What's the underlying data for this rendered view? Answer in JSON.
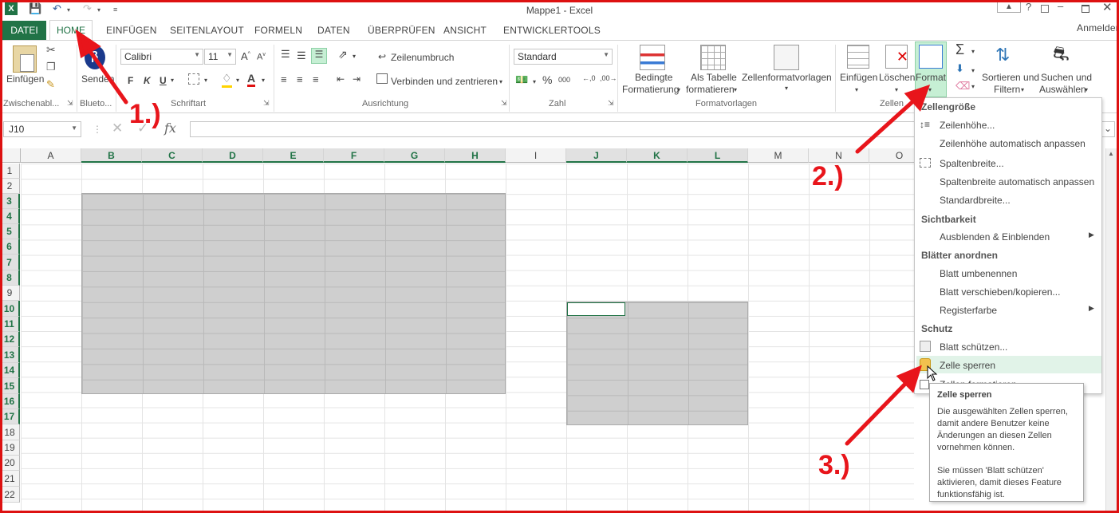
{
  "window": {
    "title": "Mappe1 - Excel",
    "signin": "Anmelden"
  },
  "tabs": [
    "DATEI",
    "HOME",
    "EINFÜGEN",
    "SEITENLAYOUT",
    "FORMELN",
    "DATEN",
    "ÜBERPRÜFEN",
    "ANSICHT",
    "ENTWICKLERTOOLS"
  ],
  "ribbon": {
    "clipboard": {
      "paste": "Einfügen",
      "group": "Zwischenabl..."
    },
    "bluetooth": {
      "send": "Senden",
      "group": "Blueto..."
    },
    "font": {
      "name": "Calibri",
      "size": "11",
      "bold": "F",
      "italic": "K",
      "underline": "U",
      "group": "Schriftart"
    },
    "alignment": {
      "wrap": "Zeilenumbruch",
      "merge": "Verbinden und zentrieren",
      "group": "Ausrichtung"
    },
    "number": {
      "format": "Standard",
      "percent": "%",
      "thousands": "000",
      "group": "Zahl"
    },
    "styles": {
      "cond1": "Bedingte",
      "cond2": "Formatierung",
      "table1": "Als Tabelle",
      "table2": "formatieren",
      "cellstyles": "Zellenformatvorlagen",
      "group": "Formatvorlagen"
    },
    "cells": {
      "insert": "Einfügen",
      "delete": "Löschen",
      "format": "Format",
      "group": "Zellen"
    },
    "editing": {
      "sort1": "Sortieren und",
      "sort2": "Filtern",
      "find1": "Suchen und",
      "find2": "Auswählen"
    }
  },
  "formula_bar": {
    "namebox": "J10",
    "fx": "fx"
  },
  "columns": [
    "A",
    "B",
    "C",
    "D",
    "E",
    "F",
    "G",
    "H",
    "I",
    "J",
    "K",
    "L",
    "M",
    "N",
    "O"
  ],
  "rows": [
    "1",
    "2",
    "3",
    "4",
    "5",
    "6",
    "7",
    "8",
    "9",
    "10",
    "11",
    "12",
    "13",
    "14",
    "15",
    "16",
    "17",
    "18",
    "19",
    "20",
    "21",
    "22"
  ],
  "menu": {
    "h_size": "Zellengröße",
    "row_height": "Zeilenhöhe...",
    "row_autofit": "Zeilenhöhe automatisch anpassen",
    "col_width": "Spaltenbreite...",
    "col_autofit": "Spaltenbreite automatisch anpassen",
    "default_width": "Standardbreite...",
    "h_visibility": "Sichtbarkeit",
    "hide_show": "Ausblenden & Einblenden",
    "h_organize": "Blätter anordnen",
    "rename": "Blatt umbenennen",
    "move_copy": "Blatt verschieben/kopieren...",
    "tab_color": "Registerfarbe",
    "h_protect": "Schutz",
    "protect_sheet": "Blatt schützen...",
    "lock_cell": "Zelle sperren",
    "format_cells": "Zellen formatieren..."
  },
  "tooltip": {
    "title": "Zelle sperren",
    "line1": "Die ausgewählten Zellen sperren,",
    "line2": "damit andere Benutzer keine",
    "line3": "Änderungen an diesen Zellen",
    "line4": "vornehmen können.",
    "line5": "Sie müssen 'Blatt schützen'",
    "line6": "aktivieren, damit dieses Feature",
    "line7": "funktionsfähig ist."
  },
  "annotations": {
    "step1": "1.)",
    "step2": "2.)",
    "step3": "3.)",
    "color": "#e8151b"
  },
  "colors": {
    "accent": "#217346",
    "selection": "#cfcfcf"
  }
}
